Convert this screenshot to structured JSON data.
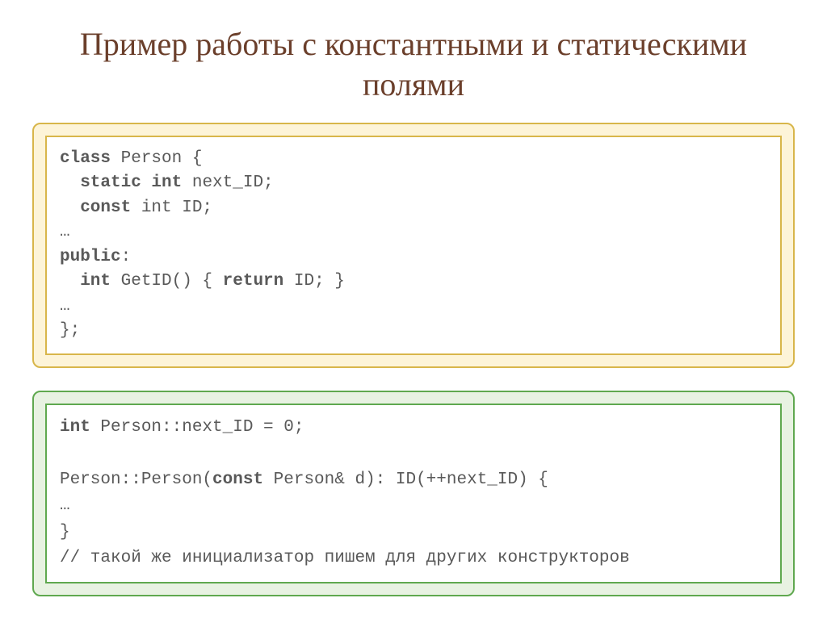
{
  "title": "Пример работы с константными и статическими полями",
  "code1": {
    "l1a": "class",
    "l1b": " Person {",
    "l2a": "  static int",
    "l2b": " next_ID;",
    "l3a": "  const",
    "l3b": " int ID;",
    "l4": "…",
    "l5a": "public",
    "l5b": ":",
    "l6a": "  int",
    "l6b": " GetID() { ",
    "l6c": "return",
    "l6d": " ID; }",
    "l7": "…",
    "l8": "};"
  },
  "code2": {
    "l1a": "int",
    "l1b": " Person::next_ID = 0;",
    "blank": " ",
    "l2a": "Person::Person(",
    "l2b": "const",
    "l2c": " Person& d): ID(++next_ID) {",
    "l3": "…",
    "l4": "}",
    "l5": "// такой же инициализатор пишем для других конструкторов"
  }
}
